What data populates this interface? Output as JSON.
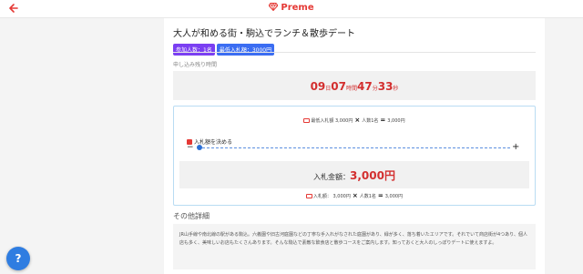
{
  "header": {
    "brand": "Preme",
    "back_icon": "arrow-left-icon",
    "brand_icon": "gem-icon",
    "accent_color": "#e53935"
  },
  "event": {
    "title": "大人が和める街・駒込でランチ＆散歩デート",
    "badges": [
      {
        "label": "参加人数：1名",
        "color": "#7b3ff2"
      },
      {
        "label": "最低入札額：3000円",
        "color": "#3b6df2"
      }
    ]
  },
  "countdown": {
    "label": "申し込み残り時間",
    "days": "09",
    "days_unit": "日",
    "hours": "07",
    "hours_unit": "時間",
    "minutes": "47",
    "minutes_unit": "分",
    "seconds": "33",
    "seconds_unit": "秒"
  },
  "bid": {
    "summary_top": {
      "label": "最低入札額",
      "base": "3,000円",
      "times": "×",
      "people": "人数1名",
      "equals": "=",
      "total": "3,000円"
    },
    "decide_label": "入札額を決める",
    "minus": "−",
    "plus": "+",
    "slider_value_fraction": 0.0,
    "amount_label": "入札金額：",
    "amount_value": "3,000円",
    "summary_bottom": {
      "label": "入札額：",
      "base": "3,000円",
      "times": "×",
      "people": "人数1名",
      "equals": "=",
      "total": "3,000円"
    }
  },
  "details": {
    "title": "その他詳細",
    "text": "JR山手線や南北線の駅がある駒込。六義園や旧古河庭園などの丁寧な手入れがなされた庭園があり、緑が多く、落ち着いたエリアです。それでいて商店街が4つあり、個人店も多く、美味しいお店もたくさんあります。そんな駒込で素敵な飲食店と散歩コースをご案内します。知っておくと大人のしっぽりデートに使えますよ。"
  },
  "help": {
    "label": "?",
    "color": "#2f7de1"
  }
}
